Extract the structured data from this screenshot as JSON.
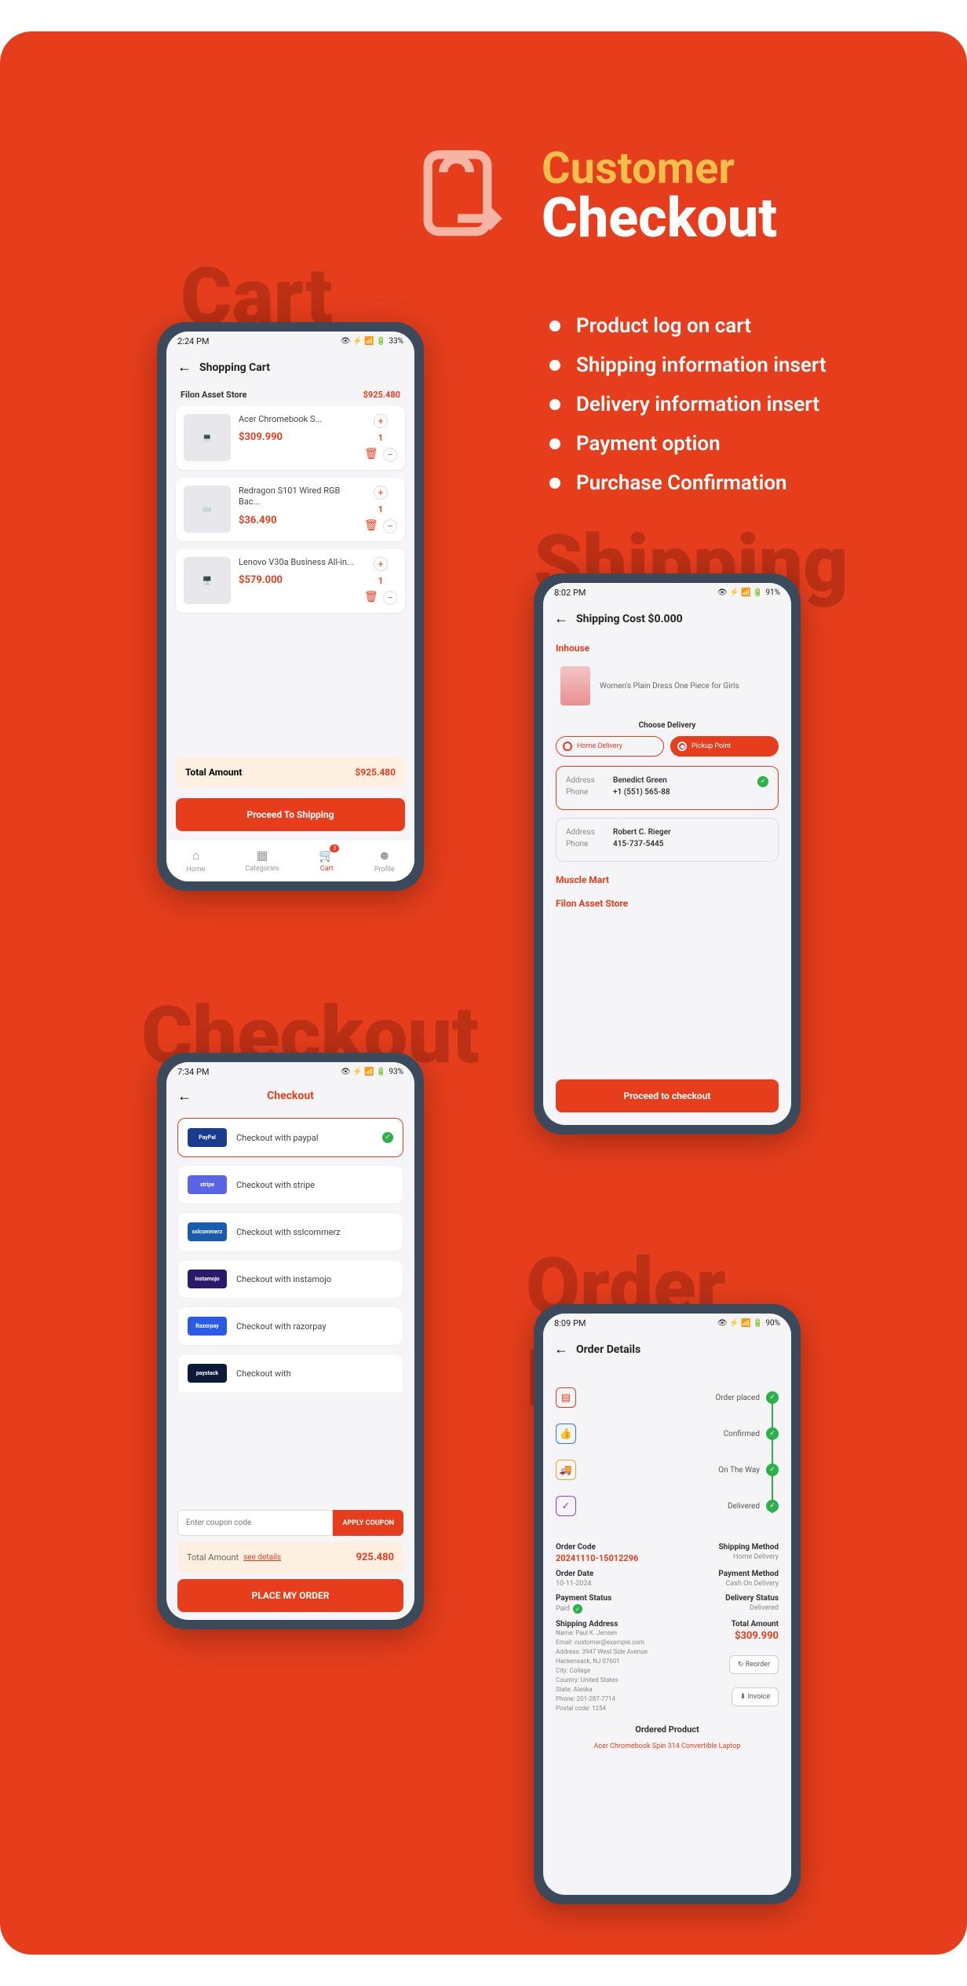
{
  "hero": {
    "line1": "Customer",
    "line2": "Checkout"
  },
  "features": [
    "Product log on cart",
    "Shipping information insert",
    "Delivery information insert",
    "Payment option",
    "Purchase Confirmation"
  ],
  "bgLabels": {
    "cart": "Cart",
    "shipping": "Shipping",
    "checkout": "Checkout",
    "order": "Order Details"
  },
  "cart": {
    "time": "2:24 PM",
    "battery": "33%",
    "title": "Shopping Cart",
    "store": "Filon Asset Store",
    "storeTotal": "$925.480",
    "items": [
      {
        "name": "Acer Chromebook S...",
        "price": "$309.990",
        "qty": "1"
      },
      {
        "name": "Redragon S101 Wired RGB Bac...",
        "price": "$36.490",
        "qty": "1"
      },
      {
        "name": "Lenovo V30a Business All-in...",
        "price": "$579.000",
        "qty": "1"
      }
    ],
    "totalLabel": "Total Amount",
    "totalValue": "$925.480",
    "proceed": "Proceed To Shipping",
    "nav": [
      {
        "l": "Home"
      },
      {
        "l": "Categories"
      },
      {
        "l": "Cart",
        "badge": "3"
      },
      {
        "l": "Profile"
      }
    ]
  },
  "shipping": {
    "time": "8:02 PM",
    "battery": "91%",
    "title": "Shipping Cost $0.000",
    "sec1": "Inhouse",
    "product": "Women's Plain Dress One Piece for Girls",
    "choose": "Choose Delivery",
    "opts": [
      "Home Delivery",
      "Pickup Point"
    ],
    "addresses": [
      {
        "name": "Benedict Green",
        "phone": "+1 (551) 565-88",
        "sel": true
      },
      {
        "name": "Robert C. Rieger",
        "phone": "415-737-5445",
        "sel": false
      }
    ],
    "addrLabel": "Address",
    "phoneLabel": "Phone",
    "sec2": "Muscle Mart",
    "sec3": "Filon Asset Store",
    "proceed": "Proceed to checkout"
  },
  "checkout": {
    "time": "7:34 PM",
    "battery": "93%",
    "title": "Checkout",
    "methods": [
      {
        "logo": "PayPal",
        "color": "#1A3C8F",
        "label": "Checkout with paypal",
        "sel": true
      },
      {
        "logo": "stripe",
        "color": "#5B63E6",
        "label": "Checkout with stripe"
      },
      {
        "logo": "sslcommerz",
        "color": "#1A5BB0",
        "label": "Checkout with sslcommerz"
      },
      {
        "logo": "instamojo",
        "color": "#2B1A6B",
        "label": "Checkout with instamojo"
      },
      {
        "logo": "Razorpay",
        "color": "#2B5BE6",
        "label": "Checkout with razorpay"
      },
      {
        "logo": "paystack",
        "color": "#0A1A3B",
        "label": "Checkout with"
      }
    ],
    "couponPlaceholder": "Enter coupon code",
    "couponBtn": "APPLY COUPON",
    "totalLabel": "Total Amount",
    "seeDetails": "see details",
    "totalValue": "925.480",
    "place": "PLACE MY ORDER"
  },
  "order": {
    "time": "8:09 PM",
    "battery": "90%",
    "title": "Order Details",
    "track": [
      "Order placed",
      "Confirmed",
      "On The Way",
      "Delivered"
    ],
    "info": {
      "codeL": "Order Code",
      "code": "20241110-15012296",
      "shipML": "Shipping Method",
      "shipM": "Home Delivery",
      "dateL": "Order Date",
      "date": "10-11-2024",
      "payML": "Payment Method",
      "payM": "Cash On Delivery",
      "payStL": "Payment Status",
      "paySt": "Paid",
      "delStL": "Delivery Status",
      "delSt": "Delivered",
      "shipAL": "Shipping Address",
      "addr": {
        "name": "Name: Paul K. Jensen",
        "email": "Email: customer@example.com",
        "address": "Address: 3947 West Side Avenue Hackensack, NJ 07601",
        "city": "City: Collage",
        "country": "Country: United States",
        "state": "State: Alaska",
        "phone": "Phone: 201-287-7714",
        "postal": "Postal code: 1254"
      },
      "totL": "Total Amount",
      "tot": "$309.990",
      "reorder": "↻ Reorder",
      "invoice": "⬇ Invoice"
    },
    "opHead": "Ordered Product",
    "opItem": "Acer Chromebook Spin 314 Convertible Laptop"
  }
}
